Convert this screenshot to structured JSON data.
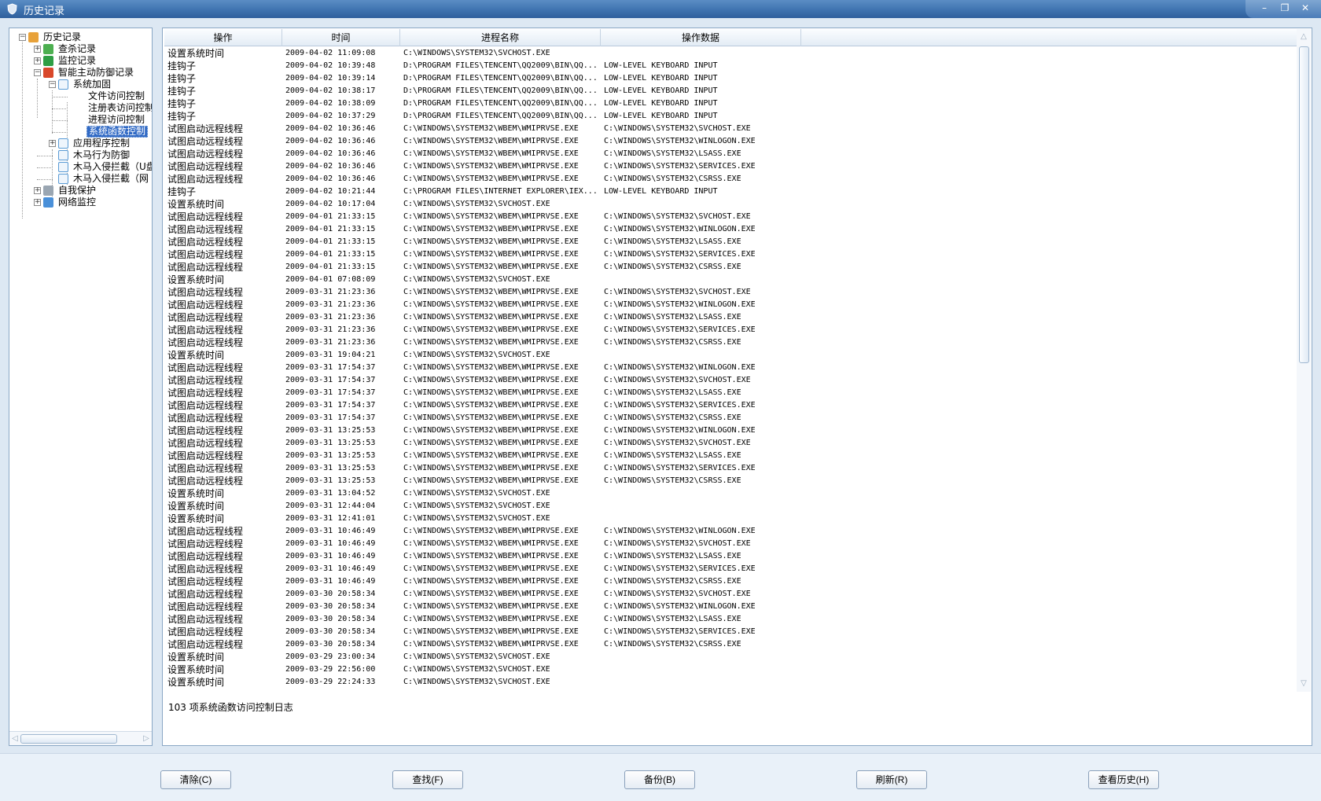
{
  "window": {
    "title": "历史记录",
    "minimize": "–",
    "restore": "❐",
    "close": "✕"
  },
  "tree": {
    "items": [
      {
        "label": "历史记录",
        "icon": "folder-icon",
        "color": "#e8a23a",
        "expander": "−"
      },
      {
        "label": "查杀记录",
        "icon": "scan-icon",
        "color": "#4caf50",
        "expander": "+"
      },
      {
        "label": "监控记录",
        "icon": "monitor-icon",
        "color": "#2e9e44",
        "expander": "+"
      },
      {
        "label": "智能主动防御记录",
        "icon": "shield-icon",
        "color": "#d9482b",
        "expander": "−"
      },
      {
        "label": "系统加固",
        "icon": "doc-icon",
        "color": "#5a9bd5",
        "expander": "−"
      },
      {
        "label": "文件访问控制",
        "icon": "",
        "color": "",
        "expander": ""
      },
      {
        "label": "注册表访问控制",
        "icon": "",
        "color": "",
        "expander": ""
      },
      {
        "label": "进程访问控制",
        "icon": "",
        "color": "",
        "expander": ""
      },
      {
        "label": "系统函数控制",
        "icon": "",
        "color": "",
        "expander": ""
      },
      {
        "label": "应用程序控制",
        "icon": "doc-icon",
        "color": "#5a9bd5",
        "expander": "+"
      },
      {
        "label": "木马行为防御",
        "icon": "doc-icon",
        "color": "#5a9bd5",
        "expander": ""
      },
      {
        "label": "木马入侵拦截（U盘",
        "icon": "doc-icon",
        "color": "#5a9bd5",
        "expander": ""
      },
      {
        "label": "木马入侵拦截（网",
        "icon": "doc-icon",
        "color": "#5a9bd5",
        "expander": ""
      },
      {
        "label": "自我保护",
        "icon": "lock-icon",
        "color": "#9aa6b2",
        "expander": "+"
      },
      {
        "label": "网络监控",
        "icon": "network-icon",
        "color": "#4a90d9",
        "expander": "+"
      }
    ],
    "selected_index": 8
  },
  "list": {
    "columns": [
      "操作",
      "时间",
      "进程名称",
      "操作数据"
    ],
    "rows": [
      [
        "设置系统时间",
        "2009-04-02 11:09:08",
        "C:\\WINDOWS\\SYSTEM32\\SVCHOST.EXE",
        ""
      ],
      [
        "挂钩子",
        "2009-04-02 10:39:48",
        "D:\\PROGRAM FILES\\TENCENT\\QQ2009\\BIN\\QQ...",
        "LOW-LEVEL KEYBOARD INPUT"
      ],
      [
        "挂钩子",
        "2009-04-02 10:39:14",
        "D:\\PROGRAM FILES\\TENCENT\\QQ2009\\BIN\\QQ...",
        "LOW-LEVEL KEYBOARD INPUT"
      ],
      [
        "挂钩子",
        "2009-04-02 10:38:17",
        "D:\\PROGRAM FILES\\TENCENT\\QQ2009\\BIN\\QQ...",
        "LOW-LEVEL KEYBOARD INPUT"
      ],
      [
        "挂钩子",
        "2009-04-02 10:38:09",
        "D:\\PROGRAM FILES\\TENCENT\\QQ2009\\BIN\\QQ...",
        "LOW-LEVEL KEYBOARD INPUT"
      ],
      [
        "挂钩子",
        "2009-04-02 10:37:29",
        "D:\\PROGRAM FILES\\TENCENT\\QQ2009\\BIN\\QQ...",
        "LOW-LEVEL KEYBOARD INPUT"
      ],
      [
        "试图启动远程线程",
        "2009-04-02 10:36:46",
        "C:\\WINDOWS\\SYSTEM32\\WBEM\\WMIPRVSE.EXE",
        "C:\\WINDOWS\\SYSTEM32\\SVCHOST.EXE"
      ],
      [
        "试图启动远程线程",
        "2009-04-02 10:36:46",
        "C:\\WINDOWS\\SYSTEM32\\WBEM\\WMIPRVSE.EXE",
        "C:\\WINDOWS\\SYSTEM32\\WINLOGON.EXE"
      ],
      [
        "试图启动远程线程",
        "2009-04-02 10:36:46",
        "C:\\WINDOWS\\SYSTEM32\\WBEM\\WMIPRVSE.EXE",
        "C:\\WINDOWS\\SYSTEM32\\LSASS.EXE"
      ],
      [
        "试图启动远程线程",
        "2009-04-02 10:36:46",
        "C:\\WINDOWS\\SYSTEM32\\WBEM\\WMIPRVSE.EXE",
        "C:\\WINDOWS\\SYSTEM32\\SERVICES.EXE"
      ],
      [
        "试图启动远程线程",
        "2009-04-02 10:36:46",
        "C:\\WINDOWS\\SYSTEM32\\WBEM\\WMIPRVSE.EXE",
        "C:\\WINDOWS\\SYSTEM32\\CSRSS.EXE"
      ],
      [
        "挂钩子",
        "2009-04-02 10:21:44",
        "C:\\PROGRAM FILES\\INTERNET EXPLORER\\IEX...",
        "LOW-LEVEL KEYBOARD INPUT"
      ],
      [
        "设置系统时间",
        "2009-04-02 10:17:04",
        "C:\\WINDOWS\\SYSTEM32\\SVCHOST.EXE",
        ""
      ],
      [
        "试图启动远程线程",
        "2009-04-01 21:33:15",
        "C:\\WINDOWS\\SYSTEM32\\WBEM\\WMIPRVSE.EXE",
        "C:\\WINDOWS\\SYSTEM32\\SVCHOST.EXE"
      ],
      [
        "试图启动远程线程",
        "2009-04-01 21:33:15",
        "C:\\WINDOWS\\SYSTEM32\\WBEM\\WMIPRVSE.EXE",
        "C:\\WINDOWS\\SYSTEM32\\WINLOGON.EXE"
      ],
      [
        "试图启动远程线程",
        "2009-04-01 21:33:15",
        "C:\\WINDOWS\\SYSTEM32\\WBEM\\WMIPRVSE.EXE",
        "C:\\WINDOWS\\SYSTEM32\\LSASS.EXE"
      ],
      [
        "试图启动远程线程",
        "2009-04-01 21:33:15",
        "C:\\WINDOWS\\SYSTEM32\\WBEM\\WMIPRVSE.EXE",
        "C:\\WINDOWS\\SYSTEM32\\SERVICES.EXE"
      ],
      [
        "试图启动远程线程",
        "2009-04-01 21:33:15",
        "C:\\WINDOWS\\SYSTEM32\\WBEM\\WMIPRVSE.EXE",
        "C:\\WINDOWS\\SYSTEM32\\CSRSS.EXE"
      ],
      [
        "设置系统时间",
        "2009-04-01 07:08:09",
        "C:\\WINDOWS\\SYSTEM32\\SVCHOST.EXE",
        ""
      ],
      [
        "试图启动远程线程",
        "2009-03-31 21:23:36",
        "C:\\WINDOWS\\SYSTEM32\\WBEM\\WMIPRVSE.EXE",
        "C:\\WINDOWS\\SYSTEM32\\SVCHOST.EXE"
      ],
      [
        "试图启动远程线程",
        "2009-03-31 21:23:36",
        "C:\\WINDOWS\\SYSTEM32\\WBEM\\WMIPRVSE.EXE",
        "C:\\WINDOWS\\SYSTEM32\\WINLOGON.EXE"
      ],
      [
        "试图启动远程线程",
        "2009-03-31 21:23:36",
        "C:\\WINDOWS\\SYSTEM32\\WBEM\\WMIPRVSE.EXE",
        "C:\\WINDOWS\\SYSTEM32\\LSASS.EXE"
      ],
      [
        "试图启动远程线程",
        "2009-03-31 21:23:36",
        "C:\\WINDOWS\\SYSTEM32\\WBEM\\WMIPRVSE.EXE",
        "C:\\WINDOWS\\SYSTEM32\\SERVICES.EXE"
      ],
      [
        "试图启动远程线程",
        "2009-03-31 21:23:36",
        "C:\\WINDOWS\\SYSTEM32\\WBEM\\WMIPRVSE.EXE",
        "C:\\WINDOWS\\SYSTEM32\\CSRSS.EXE"
      ],
      [
        "设置系统时间",
        "2009-03-31 19:04:21",
        "C:\\WINDOWS\\SYSTEM32\\SVCHOST.EXE",
        ""
      ],
      [
        "试图启动远程线程",
        "2009-03-31 17:54:37",
        "C:\\WINDOWS\\SYSTEM32\\WBEM\\WMIPRVSE.EXE",
        "C:\\WINDOWS\\SYSTEM32\\WINLOGON.EXE"
      ],
      [
        "试图启动远程线程",
        "2009-03-31 17:54:37",
        "C:\\WINDOWS\\SYSTEM32\\WBEM\\WMIPRVSE.EXE",
        "C:\\WINDOWS\\SYSTEM32\\SVCHOST.EXE"
      ],
      [
        "试图启动远程线程",
        "2009-03-31 17:54:37",
        "C:\\WINDOWS\\SYSTEM32\\WBEM\\WMIPRVSE.EXE",
        "C:\\WINDOWS\\SYSTEM32\\LSASS.EXE"
      ],
      [
        "试图启动远程线程",
        "2009-03-31 17:54:37",
        "C:\\WINDOWS\\SYSTEM32\\WBEM\\WMIPRVSE.EXE",
        "C:\\WINDOWS\\SYSTEM32\\SERVICES.EXE"
      ],
      [
        "试图启动远程线程",
        "2009-03-31 17:54:37",
        "C:\\WINDOWS\\SYSTEM32\\WBEM\\WMIPRVSE.EXE",
        "C:\\WINDOWS\\SYSTEM32\\CSRSS.EXE"
      ],
      [
        "试图启动远程线程",
        "2009-03-31 13:25:53",
        "C:\\WINDOWS\\SYSTEM32\\WBEM\\WMIPRVSE.EXE",
        "C:\\WINDOWS\\SYSTEM32\\WINLOGON.EXE"
      ],
      [
        "试图启动远程线程",
        "2009-03-31 13:25:53",
        "C:\\WINDOWS\\SYSTEM32\\WBEM\\WMIPRVSE.EXE",
        "C:\\WINDOWS\\SYSTEM32\\SVCHOST.EXE"
      ],
      [
        "试图启动远程线程",
        "2009-03-31 13:25:53",
        "C:\\WINDOWS\\SYSTEM32\\WBEM\\WMIPRVSE.EXE",
        "C:\\WINDOWS\\SYSTEM32\\LSASS.EXE"
      ],
      [
        "试图启动远程线程",
        "2009-03-31 13:25:53",
        "C:\\WINDOWS\\SYSTEM32\\WBEM\\WMIPRVSE.EXE",
        "C:\\WINDOWS\\SYSTEM32\\SERVICES.EXE"
      ],
      [
        "试图启动远程线程",
        "2009-03-31 13:25:53",
        "C:\\WINDOWS\\SYSTEM32\\WBEM\\WMIPRVSE.EXE",
        "C:\\WINDOWS\\SYSTEM32\\CSRSS.EXE"
      ],
      [
        "设置系统时间",
        "2009-03-31 13:04:52",
        "C:\\WINDOWS\\SYSTEM32\\SVCHOST.EXE",
        ""
      ],
      [
        "设置系统时间",
        "2009-03-31 12:44:04",
        "C:\\WINDOWS\\SYSTEM32\\SVCHOST.EXE",
        ""
      ],
      [
        "设置系统时间",
        "2009-03-31 12:41:01",
        "C:\\WINDOWS\\SYSTEM32\\SVCHOST.EXE",
        ""
      ],
      [
        "试图启动远程线程",
        "2009-03-31 10:46:49",
        "C:\\WINDOWS\\SYSTEM32\\WBEM\\WMIPRVSE.EXE",
        "C:\\WINDOWS\\SYSTEM32\\WINLOGON.EXE"
      ],
      [
        "试图启动远程线程",
        "2009-03-31 10:46:49",
        "C:\\WINDOWS\\SYSTEM32\\WBEM\\WMIPRVSE.EXE",
        "C:\\WINDOWS\\SYSTEM32\\SVCHOST.EXE"
      ],
      [
        "试图启动远程线程",
        "2009-03-31 10:46:49",
        "C:\\WINDOWS\\SYSTEM32\\WBEM\\WMIPRVSE.EXE",
        "C:\\WINDOWS\\SYSTEM32\\LSASS.EXE"
      ],
      [
        "试图启动远程线程",
        "2009-03-31 10:46:49",
        "C:\\WINDOWS\\SYSTEM32\\WBEM\\WMIPRVSE.EXE",
        "C:\\WINDOWS\\SYSTEM32\\SERVICES.EXE"
      ],
      [
        "试图启动远程线程",
        "2009-03-31 10:46:49",
        "C:\\WINDOWS\\SYSTEM32\\WBEM\\WMIPRVSE.EXE",
        "C:\\WINDOWS\\SYSTEM32\\CSRSS.EXE"
      ],
      [
        "试图启动远程线程",
        "2009-03-30 20:58:34",
        "C:\\WINDOWS\\SYSTEM32\\WBEM\\WMIPRVSE.EXE",
        "C:\\WINDOWS\\SYSTEM32\\SVCHOST.EXE"
      ],
      [
        "试图启动远程线程",
        "2009-03-30 20:58:34",
        "C:\\WINDOWS\\SYSTEM32\\WBEM\\WMIPRVSE.EXE",
        "C:\\WINDOWS\\SYSTEM32\\WINLOGON.EXE"
      ],
      [
        "试图启动远程线程",
        "2009-03-30 20:58:34",
        "C:\\WINDOWS\\SYSTEM32\\WBEM\\WMIPRVSE.EXE",
        "C:\\WINDOWS\\SYSTEM32\\LSASS.EXE"
      ],
      [
        "试图启动远程线程",
        "2009-03-30 20:58:34",
        "C:\\WINDOWS\\SYSTEM32\\WBEM\\WMIPRVSE.EXE",
        "C:\\WINDOWS\\SYSTEM32\\SERVICES.EXE"
      ],
      [
        "试图启动远程线程",
        "2009-03-30 20:58:34",
        "C:\\WINDOWS\\SYSTEM32\\WBEM\\WMIPRVSE.EXE",
        "C:\\WINDOWS\\SYSTEM32\\CSRSS.EXE"
      ],
      [
        "设置系统时间",
        "2009-03-29 23:00:34",
        "C:\\WINDOWS\\SYSTEM32\\SVCHOST.EXE",
        ""
      ],
      [
        "设置系统时间",
        "2009-03-29 22:56:00",
        "C:\\WINDOWS\\SYSTEM32\\SVCHOST.EXE",
        ""
      ],
      [
        "设置系统时间",
        "2009-03-29 22:24:33",
        "C:\\WINDOWS\\SYSTEM32\\SVCHOST.EXE",
        ""
      ]
    ],
    "status": "103 项系统函数访问控制日志"
  },
  "buttons": {
    "clear": "清除(C)",
    "find": "查找(F)",
    "backup": "备份(B)",
    "refresh": "刷新(R)",
    "view_history": "查看历史(H)"
  },
  "colors": {
    "titlebar": "#3f73b0",
    "selection": "#316ac5",
    "panel_border": "#8aa7c5"
  }
}
